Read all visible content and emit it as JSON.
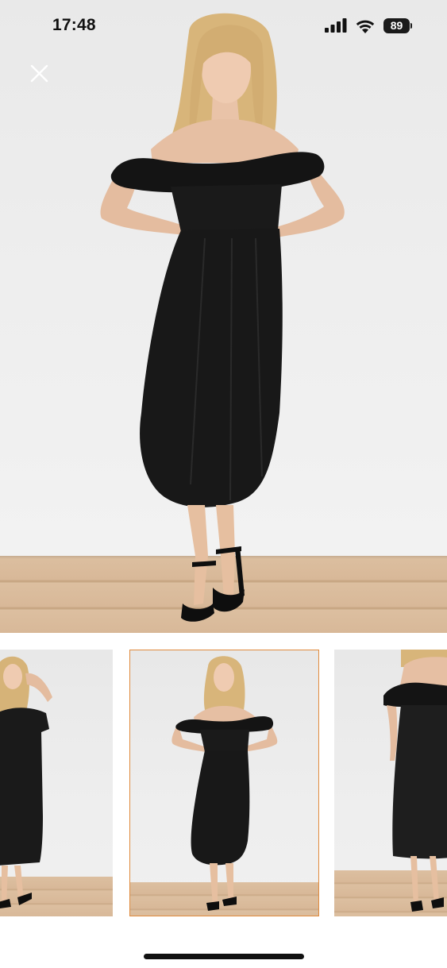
{
  "status_bar": {
    "time": "17:48",
    "battery_level": "89",
    "icons": [
      "signal-icon",
      "wifi-icon",
      "battery-icon"
    ]
  },
  "viewer": {
    "close_icon": "close-icon",
    "main_image": "product-photo-black-off-shoulder-midi-dress",
    "thumbnails": [
      {
        "image": "product-photo-side-pose",
        "selected": false
      },
      {
        "image": "product-photo-front-pose",
        "selected": true
      },
      {
        "image": "product-photo-detail-pose",
        "selected": false
      }
    ],
    "selected_border_color": "#e08a3c"
  }
}
